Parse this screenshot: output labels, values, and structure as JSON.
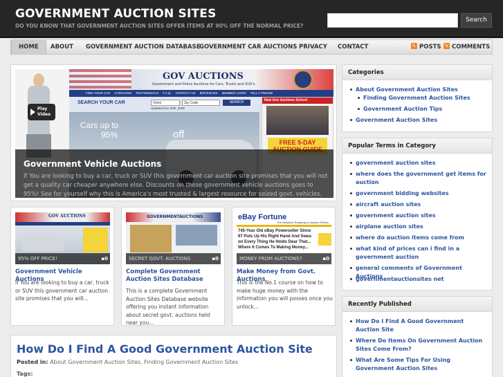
{
  "header": {
    "site_title": "GOVERNMENT AUCTION SITES",
    "site_description": "DO YOU KNOW THAT GOVERNMENT AUCTION SITES OFFER ITEMS AT 90% OFF THE NORMAL PRICE?",
    "search_placeholder": "",
    "search_button": "Search"
  },
  "nav": {
    "items": [
      "HOME",
      "ABOUT",
      "GOVERNMENT AUCTION DATABASE",
      "GOVERNMENT CAR AUCTIONS",
      "PRIVACY",
      "CONTACT"
    ],
    "posts_feed": "POSTS",
    "comments_feed": "COMMENTS"
  },
  "featured": {
    "title": "Government Vehicle Auctions",
    "text": "If You are looking to buy a car, truck or SUV this government car auction site promises that you will not get a quality car cheaper anywhere else. Discounts on these government vehicle auctions goes to 95%! See for yourself why this is America's most trusted & largest resource for seized govt. vehicles.",
    "image": {
      "logo": "GOV AUCTIONS",
      "tagline": "Government and Police Auctions for Cars, Trucks and SUV's",
      "menu": [
        "FIND YOUR CAR",
        "CARLOANS",
        "TESTIMONIALS",
        "F.A.Q.",
        "CONTACT US",
        "BOOKMARK",
        "MEMBER LOGIN",
        "TELL A FRIEND"
      ],
      "search_label": "SEARCH YOUR CAR",
      "dropdown": "Volvo",
      "zip_placeholder": "Zip Code",
      "search_btn": "SEARCH",
      "updated": "Updated Nov 26th, 2008",
      "cars_up_to": "Cars up to",
      "percent": "95%",
      "off": "off",
      "school_title": "New Gov Auctions School",
      "promo": "FREE 5-DAY AUCTION GUIDE",
      "play_video": "Play Video"
    }
  },
  "cards": [
    {
      "caption": "95% OFF PRICE!",
      "comments": "0",
      "title": "Government Vehicle Auctions",
      "text": "If You are looking to buy a car, truck or SUV this government car auction site promises that you will...",
      "thumb_logo": "GOV AUCTIONS"
    },
    {
      "caption": "SECRET GOVT. AUCTIONS",
      "comments": "0",
      "title": "Complete Government Auction Sites Database",
      "text": "This is a complete Government Auction Sites Database website offering you instant information about secret govt. auctions held near you...",
      "thumb_logo": "GOVERNMENTAUCTIONS"
    },
    {
      "caption": "MONEY FROM AUCTIONS?",
      "comments": "0",
      "title": "Make Money from Govt. Auctions",
      "text": "This is the No.1 course on how to make huge money with the information you will posses once you unlock...",
      "thumb_brand": "eBay Fortune",
      "thumb_subtitle": "The Definitive Roadmap to Auction Riches",
      "thumb_lines": [
        "745-Year Old eBay Powerseller Since",
        "97 Puts Up His Right Hand And Swea",
        "on Every Thing He Holds Dear That...",
        "Where It Comes To Making Money..."
      ]
    }
  ],
  "post": {
    "title": "How Do I Find A Good Government Auction Site",
    "posted_in_label": "Posted in:",
    "categories": "About Government Auction Sites, Finding Government Auction Sites",
    "tags_label": "Tags:"
  },
  "sidebar": {
    "categories": {
      "title": "Categories",
      "items": [
        {
          "label": "About Government Auction Sites",
          "level": 0
        },
        {
          "label": "Finding Government Auction Sites",
          "level": 1
        },
        {
          "label": "Government Auction Tips",
          "level": 1
        },
        {
          "label": "Government Auction Sites",
          "level": 0
        }
      ]
    },
    "popular": {
      "title": "Popular Terms in Category",
      "items": [
        "government auction sites",
        "where does the government get items for auction",
        "government bidding websites",
        "aircraft auction sites",
        "government auction sites",
        "airplane auction sites",
        "where do auction items come from",
        "what kind of prices can i find in a government auction",
        "general comments of Government Auctions",
        "governmentauctionsites net"
      ]
    },
    "recent": {
      "title": "Recently Published",
      "items": [
        "How Do I Find A Good Government Auction Site",
        "Where Do Items On Government Auction Sites Come From?",
        "What Are Some Tips For Using Government Auction Sites"
      ]
    }
  },
  "colors": {
    "link": "#2c55a0",
    "header_bg": "#262626",
    "rss": "#f08a24"
  }
}
